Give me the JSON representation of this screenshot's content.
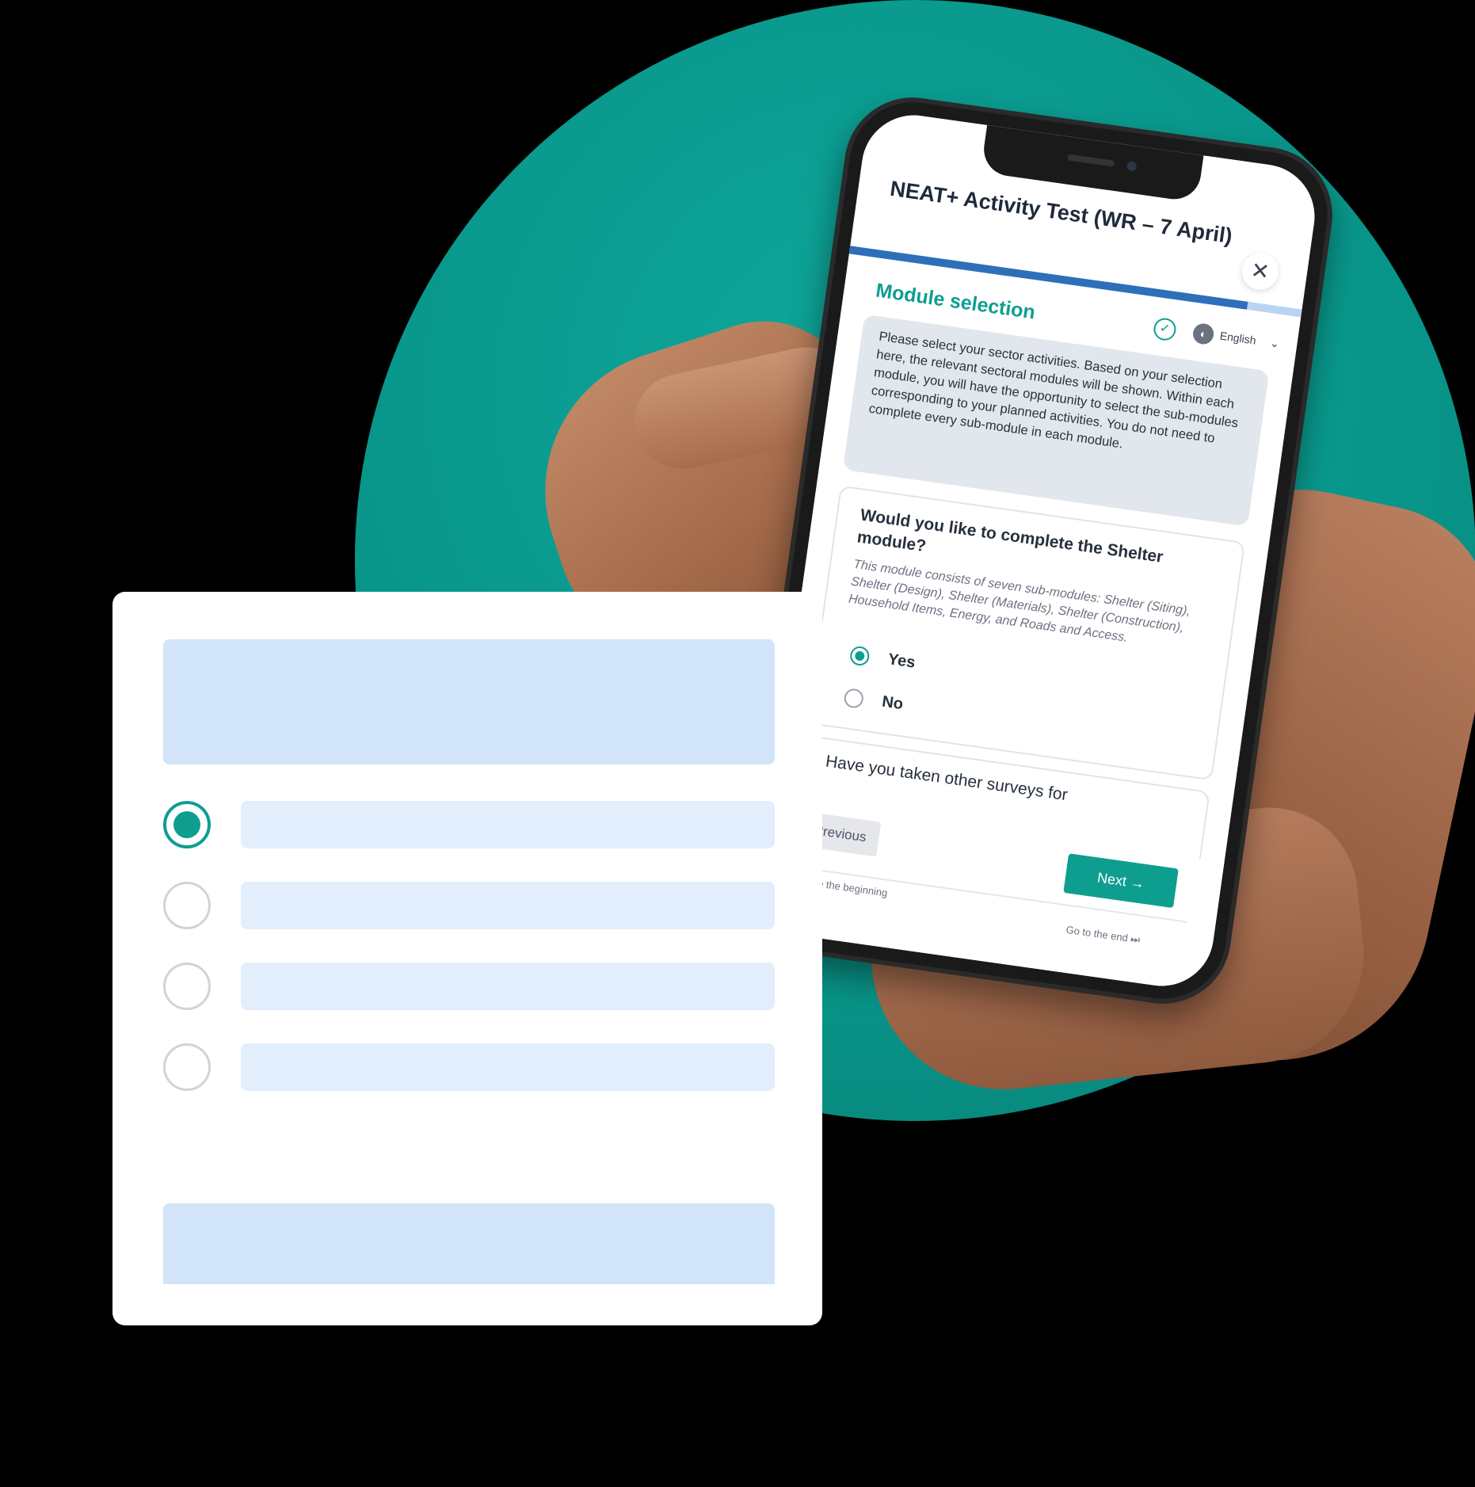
{
  "colors": {
    "accent": "#0e9e90",
    "background_circle": "#089488",
    "progress_blue": "#2f6fb9",
    "placeholder_blue": "#d2e5f8"
  },
  "phone": {
    "survey_title": "NEAT+ Activity Test (WR – 7 April)",
    "close_icon": "close-icon",
    "progress_fraction": 0.88,
    "section_heading": "Module selection",
    "language_label": "English",
    "intro_text": "Please select your sector activities. Based on your selection here, the relevant sectoral modules will be shown. Within each module, you will have the opportunity to select the sub-modules corresponding to your planned activities. You do not need to complete every sub-module in each module.",
    "question": {
      "title": "Would you like to complete the Shelter module?",
      "hint": "This module consists of seven sub-modules: Shelter (Siting), Shelter (Design), Shelter (Materials), Shelter (Construction), Household Items, Energy, and Roads and Access.",
      "options": [
        {
          "label": "Yes",
          "selected": true
        },
        {
          "label": "No",
          "selected": false
        }
      ]
    },
    "next_question_title": "Have you taken other surveys for",
    "nav": {
      "previous_label": "Previous",
      "next_label": "Next",
      "back_to_beginning": "Back to the beginning",
      "go_to_end": "Go to the end"
    }
  },
  "form_card": {
    "options": [
      {
        "selected": true
      },
      {
        "selected": false
      },
      {
        "selected": false
      },
      {
        "selected": false
      }
    ]
  }
}
